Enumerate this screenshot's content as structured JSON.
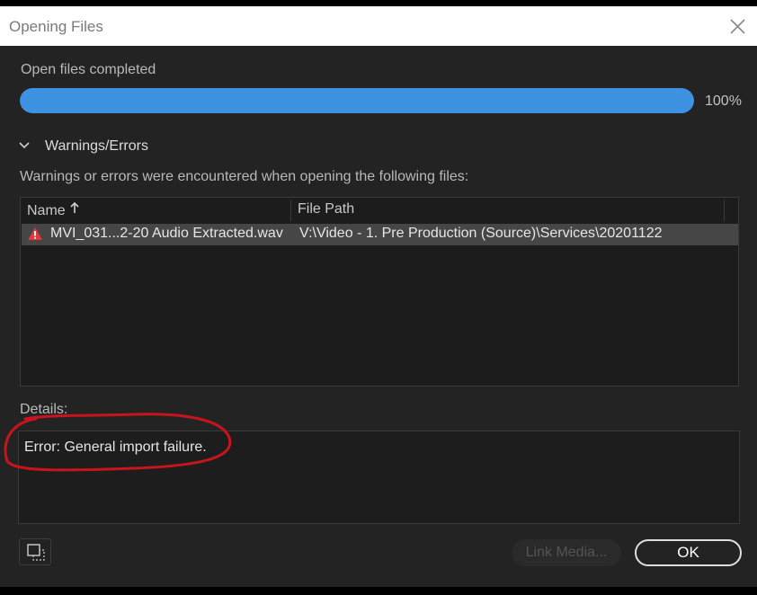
{
  "window": {
    "title": "Opening Files"
  },
  "progress": {
    "label": "Open files completed",
    "value_percent": 100,
    "percent_label": "100%",
    "fill_color": "#3d92e2"
  },
  "warnings": {
    "section_label": "Warnings/Errors",
    "expanded": true,
    "description": "Warnings or errors were encountered when opening the following files:"
  },
  "table": {
    "columns": [
      "Name",
      "File Path"
    ],
    "sort_column": "Name",
    "sort_direction": "ascending",
    "rows": [
      {
        "status_icon": "warning-icon",
        "name": "MVI_031...2-20 Audio Extracted.wav",
        "path": "V:\\Video - 1. Pre Production (Source)\\Services\\20201122"
      }
    ]
  },
  "details": {
    "label": "Details:",
    "text": "Error: General import failure.",
    "annotation_color": "#c8141c"
  },
  "buttons": {
    "link_media": "Link Media...",
    "ok": "OK"
  }
}
